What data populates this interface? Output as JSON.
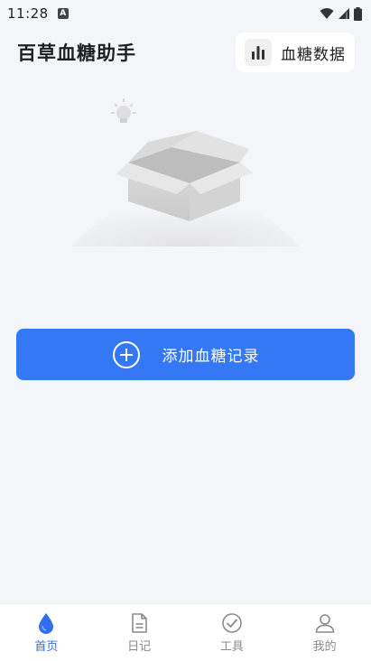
{
  "statusbar": {
    "time": "11:28",
    "badge": "A"
  },
  "header": {
    "title": "百草血糖助手",
    "data_button_label": "血糖数据"
  },
  "main": {
    "add_record_label": "添加血糖记录"
  },
  "nav": {
    "items": [
      {
        "label": "首页",
        "icon": "drop-icon",
        "active": true
      },
      {
        "label": "日记",
        "icon": "document-icon",
        "active": false
      },
      {
        "label": "工具",
        "icon": "check-circle-icon",
        "active": false
      },
      {
        "label": "我的",
        "icon": "person-icon",
        "active": false
      }
    ]
  },
  "colors": {
    "accent": "#3478f6",
    "background": "#f4f5f9",
    "inactive": "#8a8a8a"
  }
}
